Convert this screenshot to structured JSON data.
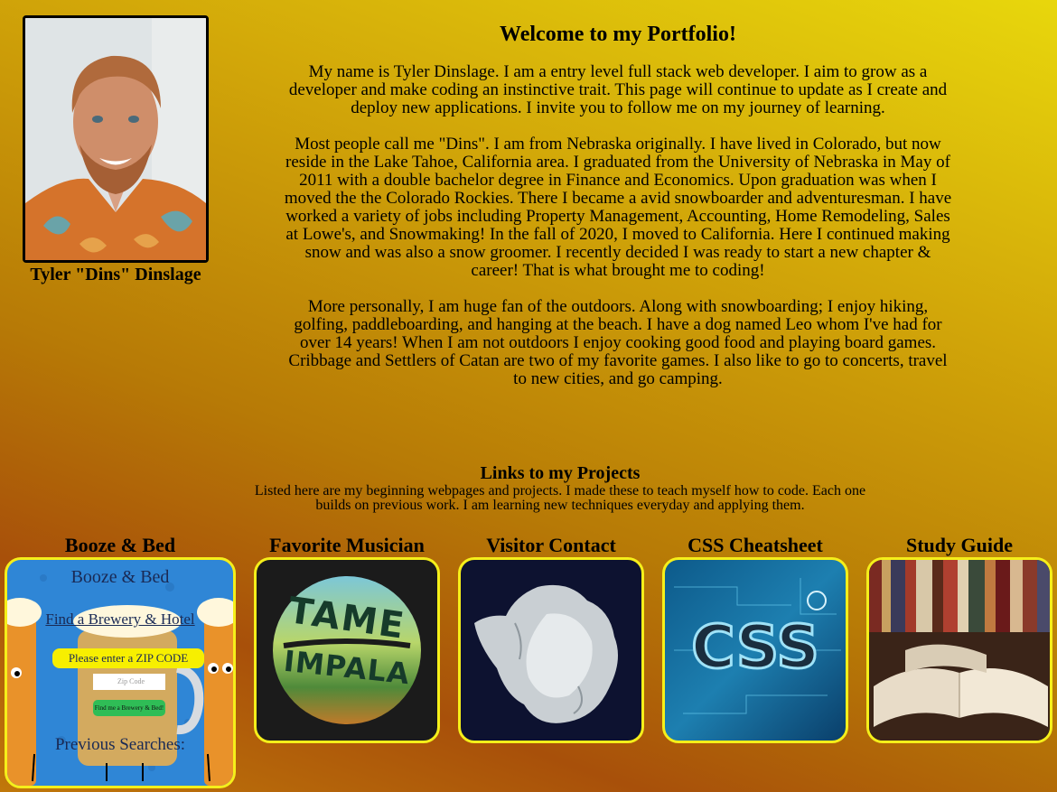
{
  "profile": {
    "name": "Tyler \"Dins\" Dinslage"
  },
  "intro": {
    "title": "Welcome to my Portfolio!",
    "paragraphs": [
      "My name is Tyler Dinslage. I am a entry level full stack web developer. I aim to grow as a developer and make coding an instinctive trait. This page will continue to update as I create and deploy new applications. I invite you to follow me on my journey of learning.",
      "Most people call me \"Dins\". I am from Nebraska originally. I have lived in Colorado, but now reside in the Lake Tahoe, California area. I graduated from the University of Nebraska in May of 2011 with a double bachelor degree in Finance and Economics. Upon graduation was when I moved the the Colorado Rockies. There I became a avid snowboarder and adventuresman. I have worked a variety of jobs including Property Management, Accounting, Home Remodeling, Sales at Lowe's, and Snowmaking! In the fall of 2020, I moved to California. Here I continued making snow and was also a snow groomer. I recently decided I was ready to start a new chapter & career! That is what brought me to coding!",
      "More personally, I am huge fan of the outdoors. Along with snowboarding; I enjoy hiking, golfing, paddleboarding, and hanging at the beach. I have a dog named Leo whom I've had for over 14 years! When I am not outdoors I enjoy cooking good food and playing board games. Cribbage and Settlers of Catan are two of my favorite games. I also like to go to concerts, travel to new cities, and go camping."
    ]
  },
  "projects": {
    "heading": "Links to my Projects",
    "description": "Listed here are my beginning webpages and projects. I made these to teach myself how to code. Each one builds on previous work. I am learning new techniques everyday and applying them.",
    "items": [
      {
        "title": "Booze & Bed",
        "thumb": {
          "heading": "Booze & Bed",
          "link": "Find a Brewery & Hotel",
          "prompt": "Please enter a ZIP CODE below!",
          "placeholder": "Zip Code",
          "button": "Find me a Brewery & Bed!",
          "footer": "Previous Searches:"
        }
      },
      {
        "title": "Favorite Musician",
        "thumb": {
          "logo_top": "TAME",
          "logo_bottom": "IMPALA"
        }
      },
      {
        "title": "Visitor Contact"
      },
      {
        "title": "CSS Cheatsheet",
        "thumb": {
          "logo": "CSS"
        }
      },
      {
        "title": "Study Guide"
      }
    ]
  },
  "colors": {
    "thumb_border": "#f5ef1a",
    "text": "#000000"
  }
}
